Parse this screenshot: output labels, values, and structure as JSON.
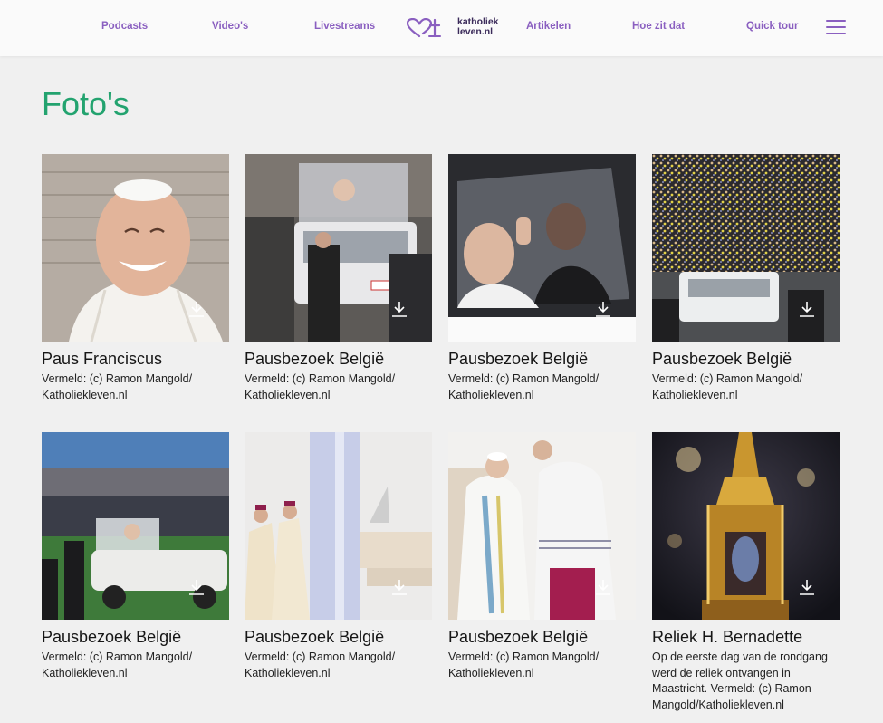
{
  "nav": {
    "links": [
      "Podcasts",
      "Video's",
      "Livestreams",
      "Artikelen",
      "Hoe zit dat",
      "Quick tour"
    ],
    "logo_line1": "katholiek",
    "logo_line2": "leven.nl"
  },
  "page": {
    "title": "Foto's"
  },
  "cards": [
    {
      "title": "Paus Franciscus",
      "caption": "Vermeld: (c) Ramon Mangold/ Katholiekleven.nl"
    },
    {
      "title": "Pausbezoek België",
      "caption": "Vermeld: (c) Ramon Mangold/ Katholiekleven.nl"
    },
    {
      "title": "Pausbezoek België",
      "caption": "Vermeld: (c) Ramon Mangold/ Katholiekleven.nl"
    },
    {
      "title": "Pausbezoek België",
      "caption": "Vermeld: (c) Ramon Mangold/ Katholiekleven.nl"
    },
    {
      "title": "Pausbezoek België",
      "caption": "Vermeld: (c) Ramon Mangold/ Katholiekleven.nl"
    },
    {
      "title": "Pausbezoek België",
      "caption": "Vermeld: (c) Ramon Mangold/ Katholiekleven.nl"
    },
    {
      "title": "Pausbezoek België",
      "caption": "Vermeld: (c) Ramon Mangold/ Katholiekleven.nl"
    },
    {
      "title": "Reliek H. Bernadette",
      "caption": "Op de eerste dag van de rondgang werd de reliek ontvangen in Maastricht. Vermeld: (c) Ramon Mangold/Katholiekleven.nl"
    }
  ],
  "icons": {
    "download": "download-icon",
    "menu": "hamburger-menu-icon",
    "logo": "heart-cross-logo-icon"
  },
  "colors": {
    "accent": "#8a5fc0",
    "title_green": "#23a36f",
    "background": "#f0f0f0"
  }
}
